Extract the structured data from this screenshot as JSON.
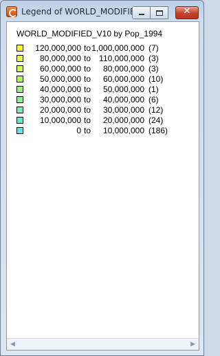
{
  "window": {
    "title": "Legend of WORLD_MODIFIE...",
    "close_glyph": "✕"
  },
  "legend": {
    "heading": "WORLD_MODIFIED_V10 by Pop_1994",
    "separator": "to",
    "rows": [
      {
        "from": "120,000,000",
        "to": "1,000,000,000",
        "count": "(7)",
        "color": "#ffff2a"
      },
      {
        "from": "80,000,000",
        "to": "110,000,000",
        "count": "(3)",
        "color": "#e8fa3a"
      },
      {
        "from": "60,000,000",
        "to": "80,000,000",
        "count": "(3)",
        "color": "#cdf74a"
      },
      {
        "from": "50,000,000",
        "to": "60,000,000",
        "count": "(10)",
        "color": "#b6f45c"
      },
      {
        "from": "40,000,000",
        "to": "50,000,000",
        "count": "(1)",
        "color": "#a0f07a"
      },
      {
        "from": "30,000,000",
        "to": "40,000,000",
        "count": "(6)",
        "color": "#8ded98"
      },
      {
        "from": "20,000,000",
        "to": "30,000,000",
        "count": "(12)",
        "color": "#7beab6"
      },
      {
        "from": "10,000,000",
        "to": "20,000,000",
        "count": "(24)",
        "color": "#6be6d2"
      },
      {
        "from": "0",
        "to": "10,000,000",
        "count": "(186)",
        "color": "#60e3ee"
      }
    ]
  },
  "scrollbar": {
    "left_glyph": "◀",
    "right_glyph": "▶"
  }
}
